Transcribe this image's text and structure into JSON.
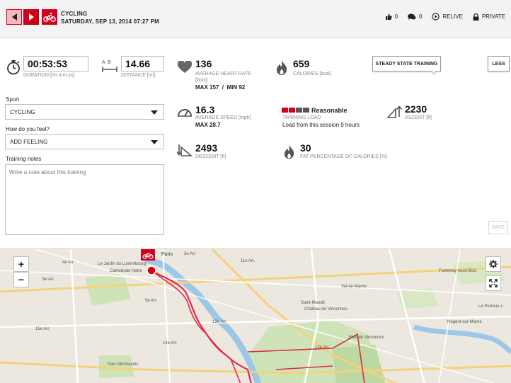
{
  "header": {
    "sport_title": "CYCLING",
    "date": "SATURDAY, SEP 13, 2014 07:27 PM",
    "likes_count": "0",
    "comments_count": "0",
    "relive_label": "RELIVE",
    "privacy_label": "PRIVATE"
  },
  "stats": {
    "duration": {
      "value": "00:53:53",
      "label": "DURATION [hh:mm:ss]"
    },
    "distance": {
      "value": "14.66",
      "label": "DISTANCE [mi]",
      "icon_text": "A  B"
    },
    "heart_rate": {
      "value": "136",
      "label": "AVERAGE HEART RATE",
      "unit": "[bpm]",
      "max_min": "MAX 157  /  MIN 92"
    },
    "calories": {
      "value": "659",
      "label": "CALORIES [kcal]"
    },
    "speed": {
      "value": "16.3",
      "label": "AVERAGE SPEED [mph]",
      "max": "MAX 28.7"
    },
    "training_load": {
      "rating": "Reasonable",
      "label": "TRAINING LOAD",
      "recovery": "Load from this session 9 hours"
    },
    "ascent": {
      "value": "2230",
      "label": "ASCENT [ft]"
    },
    "descent": {
      "value": "2493",
      "label": "DESCENT [ft]"
    },
    "fat": {
      "value": "30",
      "label": "FAT PERCENTAGE OF CALORIES [%]"
    }
  },
  "buttons": {
    "training_type": "STEADY STATE TRAINING",
    "less": "LESS",
    "save": "SAVE"
  },
  "form": {
    "sport_label": "Sport",
    "sport_value": "CYCLING",
    "feeling_label": "How do you feel?",
    "feeling_value": "ADD FEELING",
    "notes_label": "Training notes",
    "notes_placeholder": "Write a note about this training"
  },
  "map": {
    "zoom_in": "+",
    "zoom_out": "−",
    "labels": [
      "4e Arr.",
      "Cathédrale Notre",
      "Le Jardin du Luxembourg",
      "5e Arr.",
      "13e Arr.",
      "12e Arr.",
      "14e Arr.",
      "Fontenay-sous-Bois",
      "Nogent-sur-Marne",
      "Saint-Mandé",
      "Château de Vincennes",
      "Bois de Vincennes",
      "Parc Montsouris",
      "Val-de-Marne",
      "Le Perreux-s",
      "11e Arr.",
      "3e Arr.",
      "6e Arr.",
      "15e Arr.",
      "Paris"
    ]
  },
  "colors": {
    "accent": "#d0021b",
    "load_bar": [
      "#d0021b",
      "#d0021b",
      "#555555",
      "#555555"
    ]
  },
  "icons": [
    "thumbs-up-icon",
    "comment-icon",
    "play-circle-icon",
    "lock-icon",
    "stopwatch-icon",
    "distance-icon",
    "heart-icon",
    "flame-icon",
    "speedometer-icon",
    "ascent-icon",
    "descent-icon",
    "bicycle-icon",
    "gear-icon",
    "fullscreen-icon"
  ]
}
